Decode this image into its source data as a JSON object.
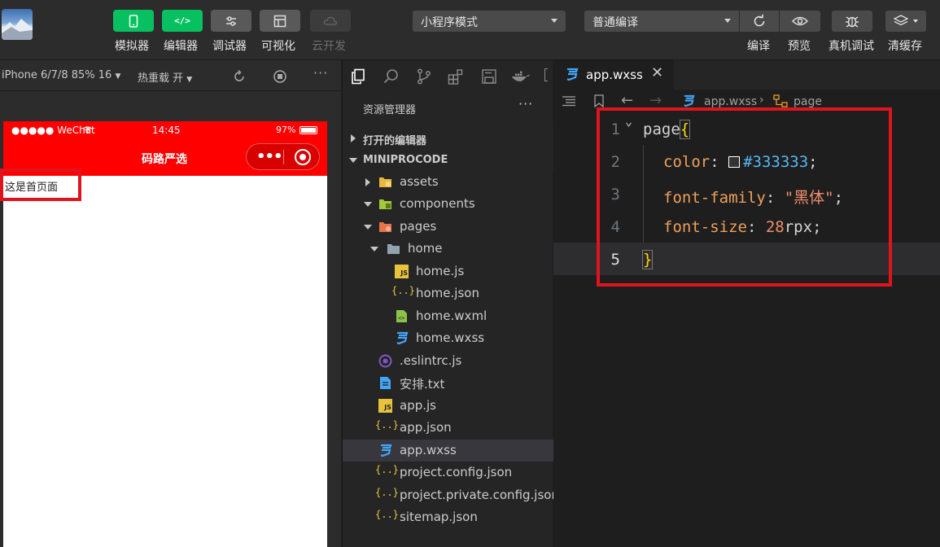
{
  "toolbar": {
    "buttons": [
      {
        "label": "模拟器"
      },
      {
        "label": "编辑器"
      },
      {
        "label": "调试器"
      },
      {
        "label": "可视化"
      },
      {
        "label": "云开发"
      }
    ],
    "mode_select": "小程序模式",
    "compile_select": "普通编译",
    "right_buttons": [
      {
        "label": "编译"
      },
      {
        "label": "预览"
      },
      {
        "label": "真机调试"
      },
      {
        "label": "清缓存"
      }
    ]
  },
  "simulator": {
    "device": "iPhone 6/7/8 85% 16",
    "hot_reload": "热重载 开",
    "status": {
      "carrier": "●●●●● WeChat",
      "time": "14:45",
      "battery": "97%"
    },
    "nav_title": "码路严选",
    "page_text": "这是首页面"
  },
  "explorer": {
    "title": "资源管理器",
    "open_editors": "打开的编辑器",
    "project": "MINIPROCODE",
    "tree": [
      {
        "label": "assets",
        "type": "folder",
        "icon": "folder-yellow-icon",
        "depth": 1,
        "expanded": false
      },
      {
        "label": "components",
        "type": "folder",
        "icon": "folder-green-icon",
        "depth": 1,
        "expanded": true
      },
      {
        "label": "pages",
        "type": "folder",
        "icon": "folder-orange-icon",
        "depth": 1,
        "expanded": true
      },
      {
        "label": "home",
        "type": "folder",
        "icon": "folder-blue-icon",
        "depth": 2,
        "expanded": true
      },
      {
        "label": "home.js",
        "type": "file",
        "icon": "js-file-icon",
        "depth": 3
      },
      {
        "label": "home.json",
        "type": "file",
        "icon": "json-file-icon",
        "depth": 3
      },
      {
        "label": "home.wxml",
        "type": "file",
        "icon": "wxml-file-icon",
        "depth": 3
      },
      {
        "label": "home.wxss",
        "type": "file",
        "icon": "css-file-icon",
        "depth": 3
      },
      {
        "label": ".eslintrc.js",
        "type": "file",
        "icon": "eslint-file-icon",
        "depth": 1
      },
      {
        "label": "安排.txt",
        "type": "file",
        "icon": "txt-file-icon",
        "depth": 1
      },
      {
        "label": "app.js",
        "type": "file",
        "icon": "js-file-icon",
        "depth": 1
      },
      {
        "label": "app.json",
        "type": "file",
        "icon": "json-file-icon",
        "depth": 1
      },
      {
        "label": "app.wxss",
        "type": "file",
        "icon": "css-file-icon",
        "depth": 1,
        "selected": true
      },
      {
        "label": "project.config.json",
        "type": "file",
        "icon": "json-file-icon",
        "depth": 1
      },
      {
        "label": "project.private.config.json",
        "type": "file",
        "icon": "json-file-icon",
        "depth": 1
      },
      {
        "label": "sitemap.json",
        "type": "file",
        "icon": "json-file-icon",
        "depth": 1
      }
    ]
  },
  "editor": {
    "tab": "app.wxss",
    "breadcrumb": [
      "app.wxss",
      "page"
    ],
    "lines": [
      {
        "n": "1",
        "selector": "page",
        "brace": "{"
      },
      {
        "n": "2",
        "prop": "color",
        "swatch": "#333333",
        "value": "#333333"
      },
      {
        "n": "3",
        "prop": "font-family",
        "value": "\"黑体\""
      },
      {
        "n": "4",
        "prop": "font-size",
        "num": "28",
        "unit": "rpx"
      },
      {
        "n": "5",
        "brace": "}"
      }
    ]
  },
  "colors": {
    "accent_green": "#07c160",
    "nav_red": "#ff0000",
    "highlight_box": "#e0141d"
  }
}
